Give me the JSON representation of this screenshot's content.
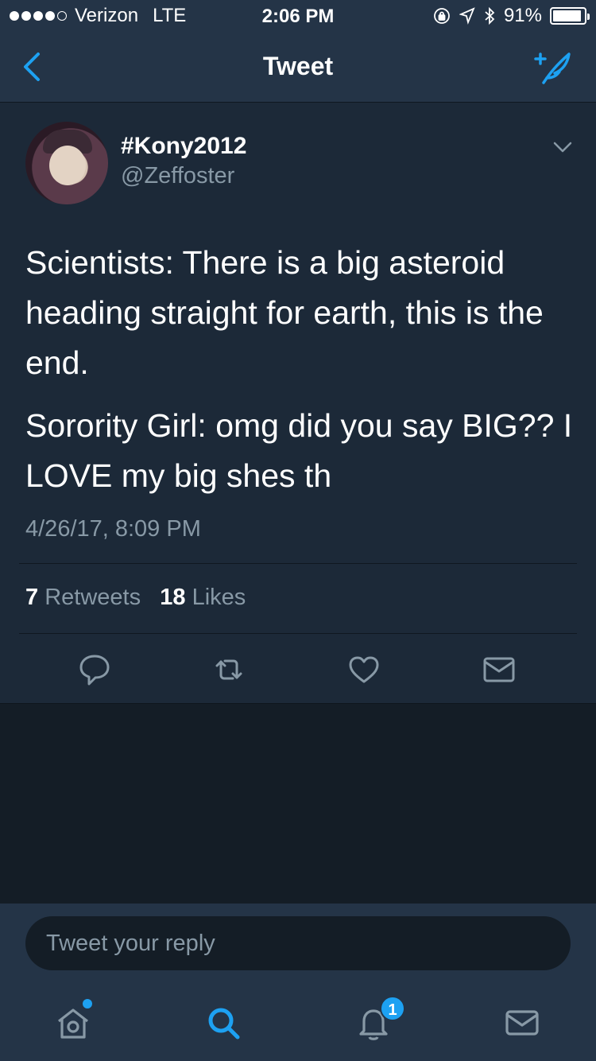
{
  "status_bar": {
    "carrier": "Verizon",
    "network": "LTE",
    "time": "2:06 PM",
    "battery": "91%",
    "battery_level": 0.91,
    "signal_bars_filled": 4,
    "signal_bars_total": 5
  },
  "nav": {
    "title": "Tweet",
    "back_icon": "chevron-left-icon",
    "compose_icon": "compose-tweet-icon"
  },
  "tweet": {
    "display_name": "#Kony2012",
    "handle": "@Zeffoster",
    "paragraphs": [
      "Scientists: There is a big asteroid heading straight for earth, this is the end.",
      "Sorority Girl: omg did you say BIG?? I LOVE my big shes th"
    ],
    "timestamp": "4/26/17, 8:09 PM",
    "retweet_count": "7",
    "retweet_label": "Retweets",
    "like_count": "18",
    "like_label": "Likes"
  },
  "reply": {
    "placeholder": "Tweet your reply"
  },
  "tabbar": {
    "items": [
      "home-icon",
      "search-icon",
      "notifications-icon",
      "messages-icon"
    ],
    "notification_badge": "1"
  },
  "colors": {
    "accent": "#1da1f2",
    "background": "#141d26",
    "card": "#1c2938",
    "bar": "#243447",
    "secondary_text": "#8899a6"
  }
}
